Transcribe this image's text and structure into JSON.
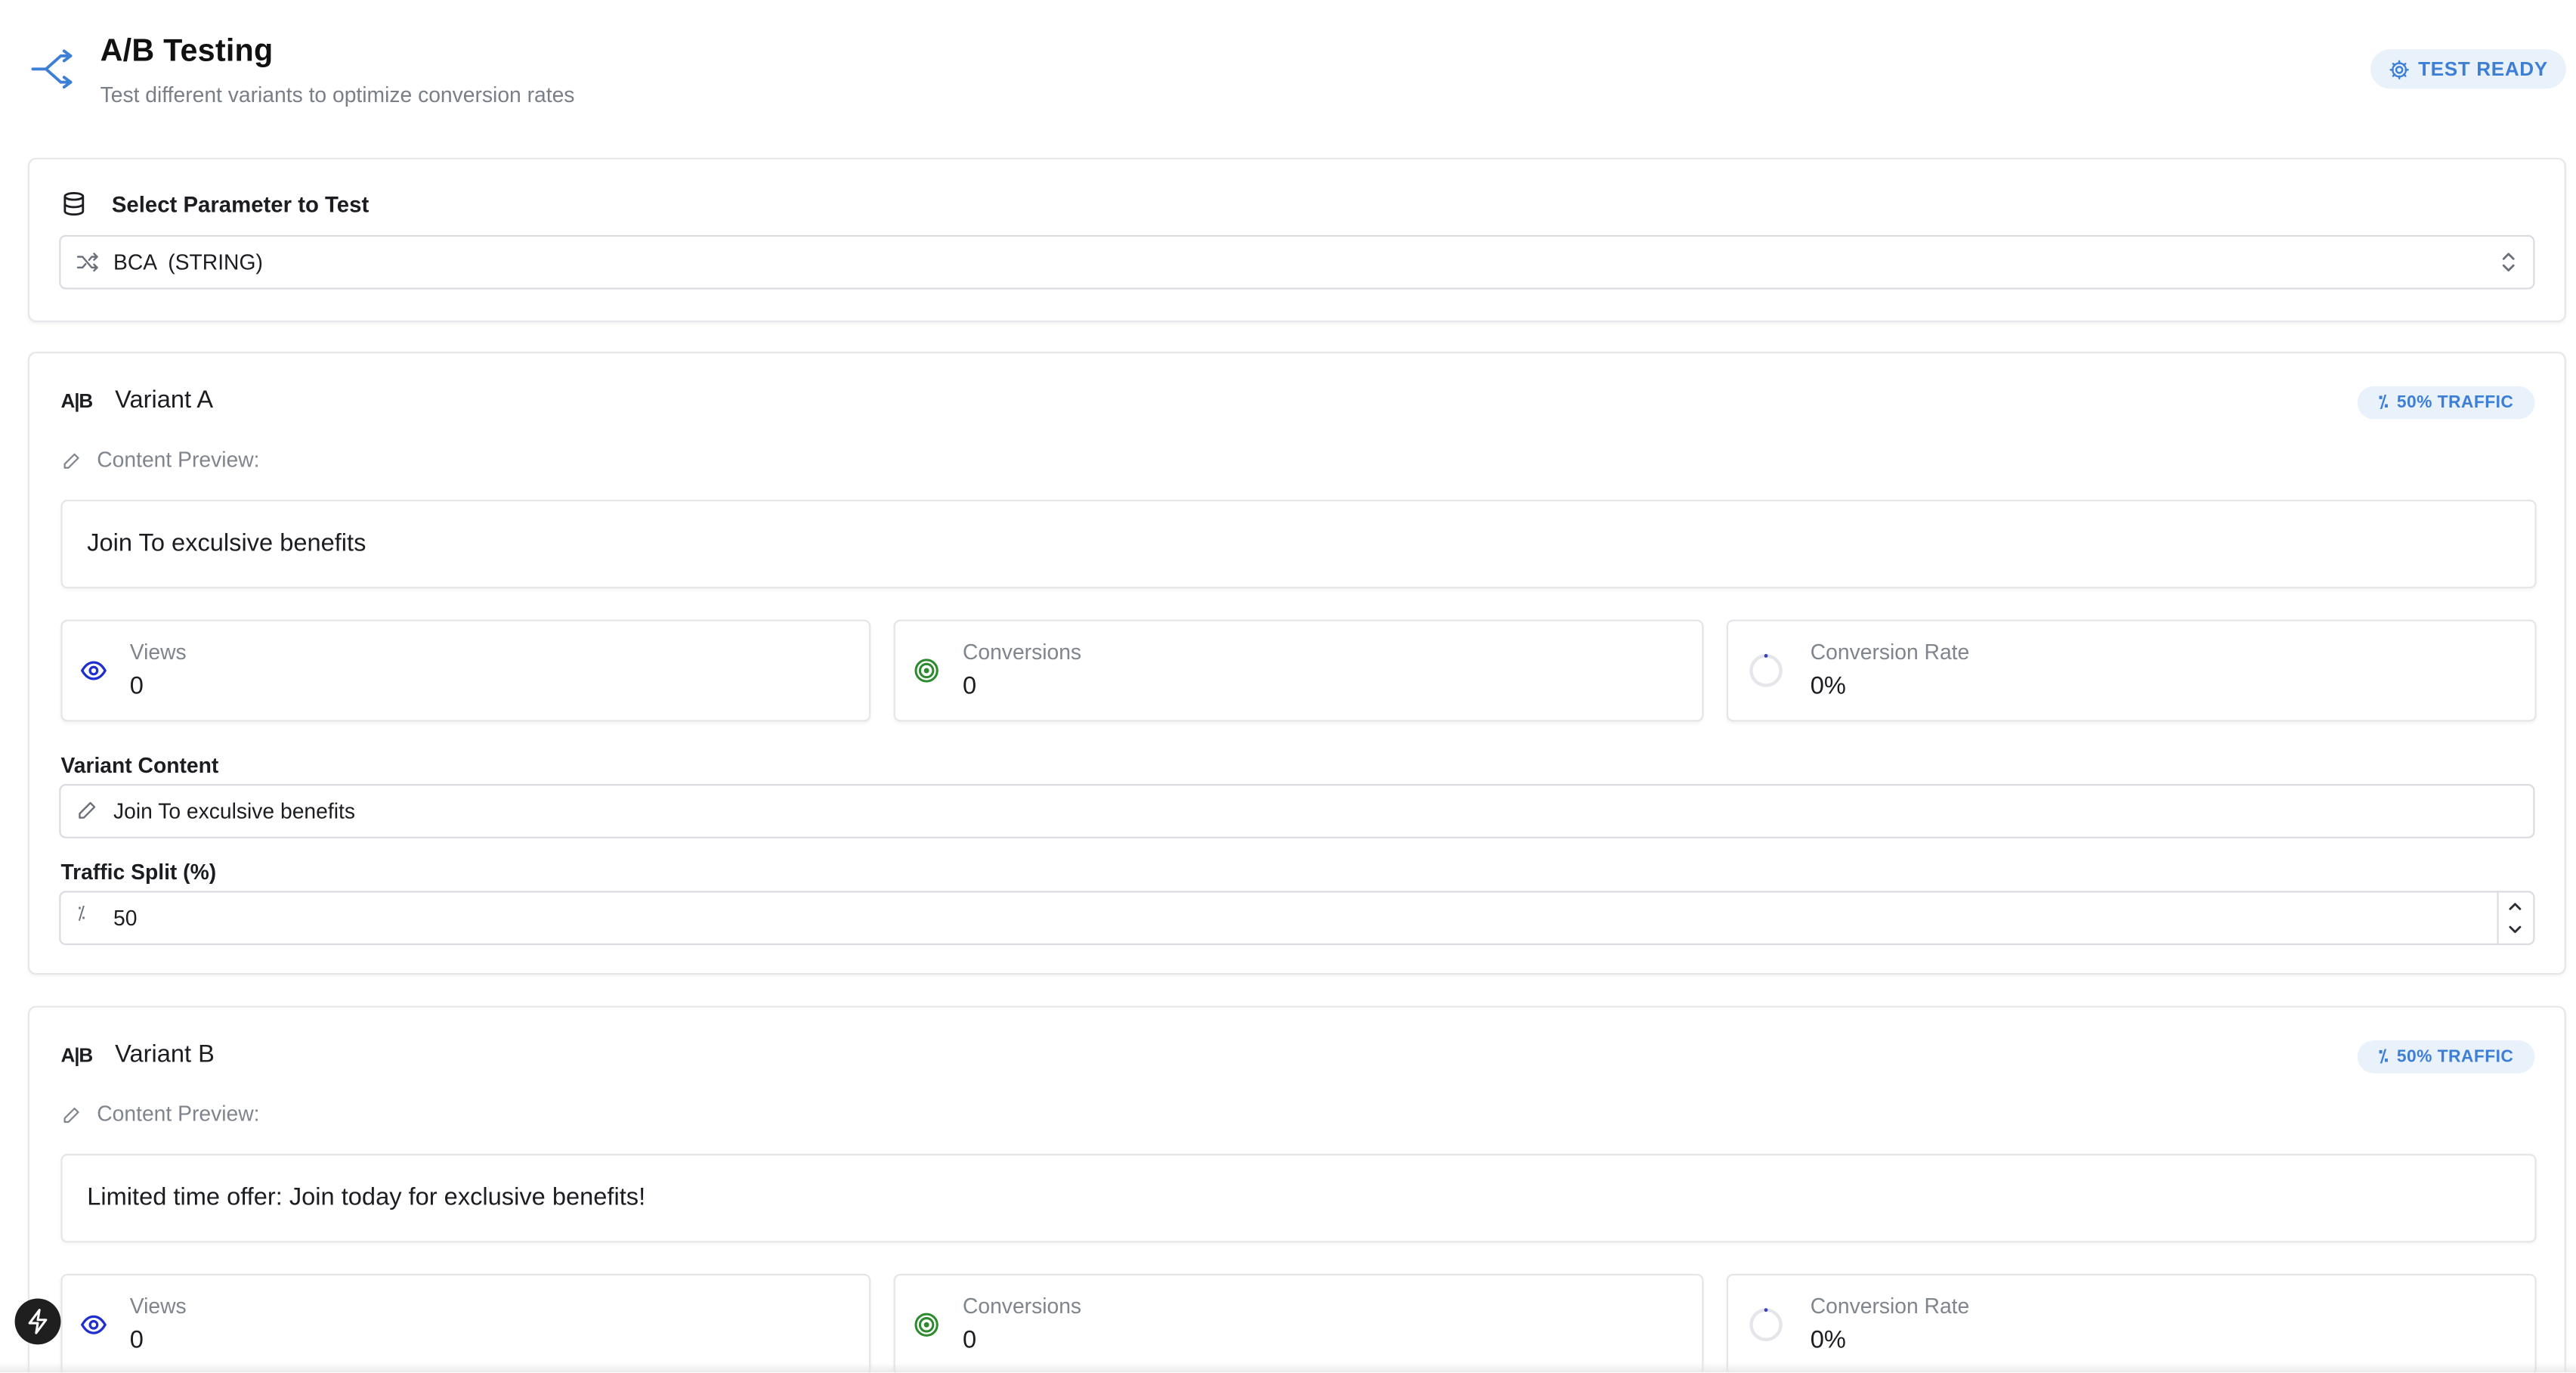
{
  "header": {
    "title": "A/B Testing",
    "subtitle": "Test different variants to optimize conversion rates",
    "status_badge": "TEST READY",
    "icon": "split-arrows-icon"
  },
  "parameter": {
    "label": "Select Parameter to Test",
    "selected_value": "BCA  (STRING)"
  },
  "variants": [
    {
      "badge_icon_text": "A|B",
      "title": "Variant A",
      "traffic_badge": "50% TRAFFIC",
      "preview_label": "Content Preview:",
      "preview_text": "Join To exculsive benefits",
      "stats": {
        "views_label": "Views",
        "views_value": "0",
        "conversions_label": "Conversions",
        "conversions_value": "0",
        "rate_label": "Conversion Rate",
        "rate_value": "0%"
      },
      "content_label": "Variant Content",
      "content_value": "Join To exculsive benefits",
      "traffic_label": "Traffic Split (%)",
      "traffic_value": "50"
    },
    {
      "badge_icon_text": "A|B",
      "title": "Variant B",
      "traffic_badge": "50% TRAFFIC",
      "preview_label": "Content Preview:",
      "preview_text": "Limited time offer: Join today for exclusive benefits!",
      "stats": {
        "views_label": "Views",
        "views_value": "0",
        "conversions_label": "Conversions",
        "conversions_value": "0",
        "rate_label": "Conversion Rate",
        "rate_value": "0%"
      }
    }
  ],
  "colors": {
    "accent": "#3d7fd6",
    "views_icon": "#1f2fd0",
    "conversions_icon": "#2e8a2e",
    "badge_bg": "#e9f1fb"
  }
}
